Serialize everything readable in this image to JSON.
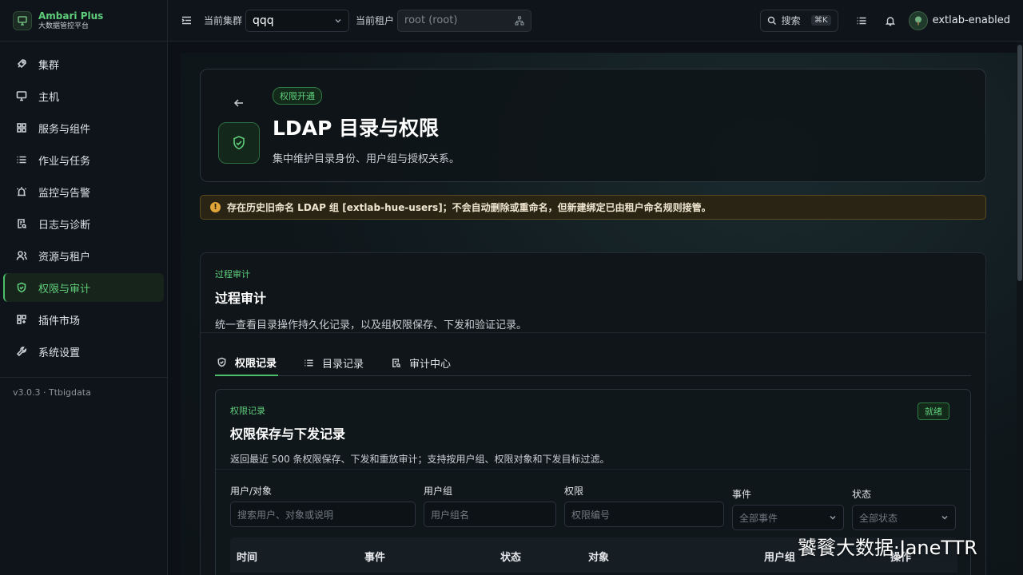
{
  "brand": {
    "title": "Ambari Plus",
    "subtitle": "大数据管控平台"
  },
  "sidebar": {
    "items": [
      {
        "label": "集群",
        "icon": "rocket-icon"
      },
      {
        "label": "主机",
        "icon": "monitor-icon"
      },
      {
        "label": "服务与组件",
        "icon": "grid-icon"
      },
      {
        "label": "作业与任务",
        "icon": "list-icon"
      },
      {
        "label": "监控与告警",
        "icon": "alarm-icon"
      },
      {
        "label": "日志与诊断",
        "icon": "file-search-icon"
      },
      {
        "label": "资源与租户",
        "icon": "users-icon"
      },
      {
        "label": "权限与审计",
        "icon": "shield-icon",
        "active": true
      },
      {
        "label": "插件市场",
        "icon": "puzzle-icon"
      },
      {
        "label": "系统设置",
        "icon": "wrench-icon"
      }
    ],
    "version": "v3.0.3 · Ttbigdata"
  },
  "topbar": {
    "cluster_label": "当前集群",
    "cluster_value": "qqq",
    "tenant_label": "当前租户",
    "tenant_value": "root (root)",
    "search_label": "搜索",
    "search_shortcut": "⌘K",
    "user": "extlab-enabled"
  },
  "hero": {
    "badge": "权限开通",
    "title": "LDAP 目录与权限",
    "description": "集中维护目录身份、用户组与授权关系。"
  },
  "alert": {
    "icon": "!",
    "text": "存在历史旧命名 LDAP 组 [extlab-hue-users]；不会自动删除或重命名，但新建绑定已由租户命名规则接管。"
  },
  "audit": {
    "eyebrow": "过程审计",
    "title": "过程审计",
    "description": "统一查看目录操作持久化记录，以及组权限保存、下发和验证记录。",
    "tabs": [
      {
        "label": "权限记录",
        "active": true
      },
      {
        "label": "目录记录"
      },
      {
        "label": "审计中心"
      }
    ]
  },
  "records": {
    "eyebrow": "权限记录",
    "title": "权限保存与下发记录",
    "description": "返回最近 500 条权限保存、下发和重放审计；支持按用户组、权限对象和下发目标过滤。",
    "status": "就绪",
    "filters": {
      "user_label": "用户/对象",
      "user_placeholder": "搜索用户、对象或说明",
      "group_label": "用户组",
      "group_placeholder": "用户组名",
      "perm_label": "权限",
      "perm_placeholder": "权限编号",
      "event_label": "事件",
      "event_value": "全部事件",
      "status_label": "状态",
      "status_value": "全部状态"
    },
    "columns": [
      "时间",
      "事件",
      "状态",
      "对象",
      "用户组",
      "操作"
    ]
  },
  "watermark": "饕餮大数据·JaneTTR"
}
